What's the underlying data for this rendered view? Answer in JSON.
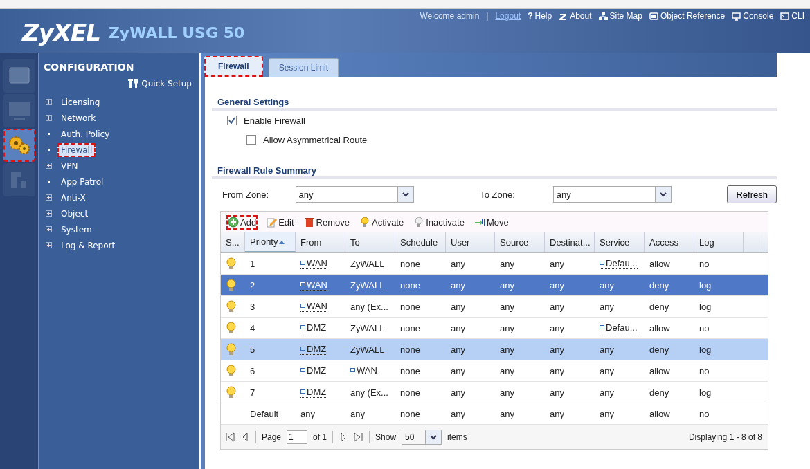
{
  "header": {
    "logo": "ZyXEL",
    "product": "ZyWALL USG 50",
    "welcome": "Welcome admin",
    "separator": "|",
    "logout": "Logout",
    "links": [
      {
        "kind": "help",
        "label": "Help",
        "glyph": "?"
      },
      {
        "kind": "about",
        "label": "About"
      },
      {
        "kind": "sitemap",
        "label": "Site Map"
      },
      {
        "kind": "object",
        "label": "Object Reference"
      },
      {
        "kind": "console",
        "label": "Console"
      },
      {
        "kind": "cli",
        "label": "CLI"
      }
    ]
  },
  "side_icons": [
    {
      "kind": "dashboard",
      "selected": false,
      "highlighted": false
    },
    {
      "kind": "monitor",
      "selected": false,
      "highlighted": false
    },
    {
      "kind": "configuration",
      "selected": true,
      "highlighted": true
    },
    {
      "kind": "maintenance",
      "selected": false,
      "highlighted": false
    }
  ],
  "sidebar": {
    "title": "CONFIGURATION",
    "quick_setup": "Quick Setup",
    "items": [
      {
        "label": "Licensing",
        "kind": "expand",
        "selected": false,
        "highlighted": false
      },
      {
        "label": "Network",
        "kind": "expand",
        "selected": false,
        "highlighted": false
      },
      {
        "label": "Auth. Policy",
        "kind": "leaf",
        "selected": false,
        "highlighted": false
      },
      {
        "label": "Firewall",
        "kind": "leaf",
        "selected": true,
        "highlighted": true
      },
      {
        "label": "VPN",
        "kind": "expand",
        "selected": false,
        "highlighted": false
      },
      {
        "label": "App Patrol",
        "kind": "leaf",
        "selected": false,
        "highlighted": false
      },
      {
        "label": "Anti-X",
        "kind": "expand",
        "selected": false,
        "highlighted": false
      },
      {
        "label": "Object",
        "kind": "expand",
        "selected": false,
        "highlighted": false
      },
      {
        "label": "System",
        "kind": "expand",
        "selected": false,
        "highlighted": false
      },
      {
        "label": "Log & Report",
        "kind": "expand",
        "selected": false,
        "highlighted": false
      }
    ]
  },
  "tabs": [
    {
      "label": "Firewall",
      "selected": true,
      "highlighted": true
    },
    {
      "label": "Session Limit",
      "selected": false,
      "highlighted": false
    }
  ],
  "general_settings": {
    "title": "General Settings",
    "options": [
      {
        "label": "Enable Firewall",
        "checked": true
      },
      {
        "label": "Allow Asymmetrical Route",
        "checked": false
      }
    ]
  },
  "rule_summary": {
    "title": "Firewall Rule Summary",
    "from_zone": {
      "label": "From Zone:",
      "value": "any"
    },
    "to_zone": {
      "label": "To Zone:",
      "value": "any"
    },
    "refresh": "Refresh"
  },
  "toolbar": [
    {
      "kind": "add",
      "label": "Add",
      "highlighted": true
    },
    {
      "kind": "edit",
      "label": "Edit",
      "highlighted": false
    },
    {
      "kind": "remove",
      "label": "Remove",
      "highlighted": false
    },
    {
      "kind": "activate",
      "label": "Activate",
      "highlighted": false
    },
    {
      "kind": "inactivate",
      "label": "Inactivate",
      "highlighted": false
    },
    {
      "kind": "move",
      "label": "Move",
      "highlighted": false
    }
  ],
  "table": {
    "columns": [
      {
        "label": "S...",
        "sorted": false
      },
      {
        "label": "Priority",
        "sorted": true
      },
      {
        "label": "From",
        "sorted": false
      },
      {
        "label": "To",
        "sorted": false
      },
      {
        "label": "Schedule",
        "sorted": false
      },
      {
        "label": "User",
        "sorted": false
      },
      {
        "label": "Source",
        "sorted": false
      },
      {
        "label": "Destinat...",
        "sorted": false
      },
      {
        "label": "Service",
        "sorted": false
      },
      {
        "label": "Access",
        "sorted": false
      },
      {
        "label": "Log",
        "sorted": false
      }
    ],
    "rows": [
      {
        "active": true,
        "selected": false,
        "hovered": false,
        "cells": [
          "",
          "1",
          {
            "text": "WAN",
            "object": true
          },
          "ZyWALL",
          "none",
          "any",
          "any",
          "any",
          {
            "text": "Defau...",
            "object": true
          },
          "allow",
          "no"
        ]
      },
      {
        "active": true,
        "selected": true,
        "hovered": false,
        "cells": [
          "",
          "2",
          {
            "text": "WAN",
            "object": true
          },
          "ZyWALL",
          "none",
          "any",
          "any",
          "any",
          "any",
          "deny",
          "log"
        ]
      },
      {
        "active": true,
        "selected": false,
        "hovered": false,
        "cells": [
          "",
          "3",
          {
            "text": "WAN",
            "object": true
          },
          "any (Ex...",
          "none",
          "any",
          "any",
          "any",
          "any",
          "deny",
          "log"
        ]
      },
      {
        "active": true,
        "selected": false,
        "hovered": false,
        "cells": [
          "",
          "4",
          {
            "text": "DMZ",
            "object": true
          },
          "ZyWALL",
          "none",
          "any",
          "any",
          "any",
          {
            "text": "Defau...",
            "object": true
          },
          "allow",
          "no"
        ]
      },
      {
        "active": true,
        "selected": false,
        "hovered": true,
        "cells": [
          "",
          "5",
          {
            "text": "DMZ",
            "object": true
          },
          "ZyWALL",
          "none",
          "any",
          "any",
          "any",
          "any",
          "deny",
          "log"
        ]
      },
      {
        "active": true,
        "selected": false,
        "hovered": false,
        "cells": [
          "",
          "6",
          {
            "text": "DMZ",
            "object": true
          },
          {
            "text": "WAN",
            "object": true
          },
          "none",
          "any",
          "any",
          "any",
          "any",
          "allow",
          "no"
        ]
      },
      {
        "active": true,
        "selected": false,
        "hovered": false,
        "cells": [
          "",
          "7",
          {
            "text": "DMZ",
            "object": true
          },
          "any (Ex...",
          "none",
          "any",
          "any",
          "any",
          "any",
          "deny",
          "log"
        ]
      },
      {
        "active": false,
        "selected": false,
        "hovered": false,
        "cells": [
          "",
          "Default",
          "any",
          "any",
          "none",
          "any",
          "any",
          "any",
          "any",
          "allow",
          "no"
        ]
      }
    ]
  },
  "pager": {
    "page_label": "Page",
    "page": "1",
    "of": "of 1",
    "show": "Show",
    "per_page": "50",
    "items": "items",
    "displaying": "Displaying 1 - 8 of 8"
  }
}
